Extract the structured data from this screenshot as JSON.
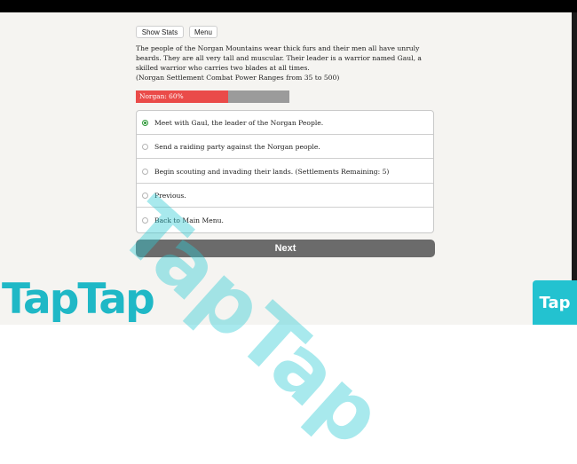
{
  "toolbar": {
    "show_stats_label": "Show Stats",
    "menu_label": "Menu"
  },
  "description": {
    "text": "The people of the Norgan Mountains wear thick furs and their men all have unruly beards. They are all very tall and muscular. Their leader is a warrior named Gaul, a skilled warrior who carries two blades at all times.",
    "note": "(Norgan Settlement Combat Power Ranges from 35 to 500)"
  },
  "progress": {
    "label": "Norgan: 60%",
    "value_percent": 60,
    "fill_color": "#ea4b49",
    "track_color": "#9b9b9b"
  },
  "choices": [
    {
      "label": "Meet with Gaul, the leader of the Norgan People.",
      "selected": true
    },
    {
      "label": "Send a raiding party against the Norgan people.",
      "selected": false
    },
    {
      "label": "Begin scouting and invading their lands. (Settlements Remaining: 5)",
      "selected": false
    },
    {
      "label": "Previous.",
      "selected": false
    },
    {
      "label": "Back to Main Menu.",
      "selected": false
    }
  ],
  "next_label": "Next",
  "watermark": {
    "big_text": "TapTap",
    "logo_text": "TapTap",
    "badge_text": "Tap",
    "color": "#23c2d0"
  }
}
